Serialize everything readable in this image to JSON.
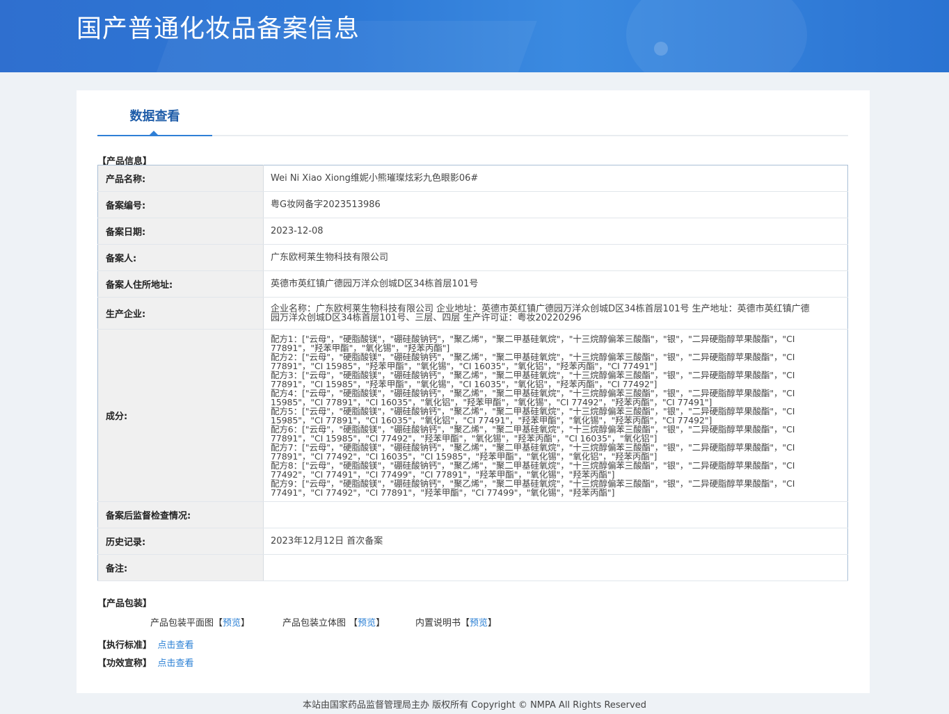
{
  "header": {
    "title": "国产普通化妆品备案信息"
  },
  "tab": {
    "label": "数据查看"
  },
  "sections": {
    "product_info": "【产品信息】",
    "packaging": "【产品包装】",
    "standard": "【执行标准】",
    "efficacy": "【功效宣称】"
  },
  "rows": [
    {
      "label": "产品名称:",
      "value": "Wei Ni Xiao Xiong维妮小熊璀璨炫彩九色眼影06#"
    },
    {
      "label": "备案编号:",
      "value": "粤G妆网备字2023513986"
    },
    {
      "label": "备案日期:",
      "value": "2023-12-08"
    },
    {
      "label": "备案人:",
      "value": "广东欧柯莱生物科技有限公司"
    },
    {
      "label": "备案人住所地址:",
      "value": "英德市英红镇广德园万洋众创城D区34栋首层101号"
    },
    {
      "label": "生产企业:",
      "value": "企业名称：广东欧柯莱生物科技有限公司 企业地址：英德市英红镇广德园万洋众创城D区34栋首层101号 生产地址：英德市英红镇广德园万洋众创城D区34栋首层101号、三层、四层 生产许可证：粤妆20220296"
    },
    {
      "label": "成分:",
      "value": ""
    },
    {
      "label": "备案后监督检查情况:",
      "value": ""
    },
    {
      "label": "历史记录:",
      "value": "2023年12月12日 首次备案"
    },
    {
      "label": "备注:",
      "value": ""
    }
  ],
  "ingredients": [
    "配方1：[\"云母\"，\"硬脂酸镁\"，\"硼硅酸钠钙\"，\"聚乙烯\"，\"聚二甲基硅氧烷\"，\"十三烷醇偏苯三酸酯\"，\"银\"，\"二异硬脂醇苹果酸酯\"，\"CI 77891\"，\"羟苯甲酯\"，\"氧化锡\"，\"羟苯丙酯\"]",
    "配方2：[\"云母\"，\"硬脂酸镁\"，\"硼硅酸钠钙\"，\"聚乙烯\"，\"聚二甲基硅氧烷\"，\"十三烷醇偏苯三酸酯\"，\"银\"，\"二异硬脂醇苹果酸酯\"，\"CI 77891\"，\"CI 15985\"，\"羟苯甲酯\"，\"氧化锡\"，\"CI 16035\"，\"氧化铝\"，\"羟苯丙酯\"，\"CI 77491\"]",
    "配方3：[\"云母\"，\"硬脂酸镁\"，\"硼硅酸钠钙\"，\"聚乙烯\"，\"聚二甲基硅氧烷\"，\"十三烷醇偏苯三酸酯\"，\"银\"，\"二异硬脂醇苹果酸酯\"，\"CI 77891\"，\"CI 15985\"，\"羟苯甲酯\"，\"氧化锡\"，\"CI 16035\"，\"氧化铝\"，\"羟苯丙酯\"，\"CI 77492\"]",
    "配方4：[\"云母\"，\"硬脂酸镁\"，\"硼硅酸钠钙\"，\"聚乙烯\"，\"聚二甲基硅氧烷\"，\"十三烷醇偏苯三酸酯\"，\"银\"，\"二异硬脂醇苹果酸酯\"，\"CI 15985\"，\"CI 77891\"，\"CI 16035\"，\"氧化铝\"，\"羟苯甲酯\"，\"氧化锡\"，\"CI 77492\"，\"羟苯丙酯\"，\"CI 77491\"]",
    "配方5：[\"云母\"，\"硬脂酸镁\"，\"硼硅酸钠钙\"，\"聚乙烯\"，\"聚二甲基硅氧烷\"，\"十三烷醇偏苯三酸酯\"，\"银\"，\"二异硬脂醇苹果酸酯\"，\"CI 15985\"，\"CI 77891\"，\"CI 16035\"，\"氧化铝\"，\"CI 77491\"，\"羟苯甲酯\"，\"氧化锡\"，\"羟苯丙酯\"，\"CI 77492\"]",
    "配方6：[\"云母\"，\"硬脂酸镁\"，\"硼硅酸钠钙\"，\"聚乙烯\"，\"聚二甲基硅氧烷\"，\"十三烷醇偏苯三酸酯\"，\"银\"，\"二异硬脂醇苹果酸酯\"，\"CI 77891\"，\"CI 15985\"，\"CI 77492\"，\"羟苯甲酯\"，\"氧化锡\"，\"羟苯丙酯\"，\"CI 16035\"，\"氧化铝\"]",
    "配方7：[\"云母\"，\"硬脂酸镁\"，\"硼硅酸钠钙\"，\"聚乙烯\"，\"聚二甲基硅氧烷\"，\"十三烷醇偏苯三酸酯\"，\"银\"，\"二异硬脂醇苹果酸酯\"，\"CI 77891\"，\"CI 77492\"，\"CI 16035\"，\"CI 15985\"，\"羟苯甲酯\"，\"氧化锡\"，\"氧化铝\"，\"羟苯丙酯\"]",
    "配方8：[\"云母\"，\"硬脂酸镁\"，\"硼硅酸钠钙\"，\"聚乙烯\"，\"聚二甲基硅氧烷\"，\"十三烷醇偏苯三酸酯\"，\"银\"，\"二异硬脂醇苹果酸酯\"，\"CI 77492\"，\"CI 77491\"，\"CI 77499\"，\"CI 77891\"，\"羟苯甲酯\"，\"氧化锡\"，\"羟苯丙酯\"]",
    "配方9：[\"云母\"，\"硬脂酸镁\"，\"硼硅酸钠钙\"，\"聚乙烯\"，\"聚二甲基硅氧烷\"，\"十三烷醇偏苯三酸酯\"，\"银\"，\"二异硬脂醇苹果酸酯\"，\"CI 77491\"，\"CI 77492\"，\"CI 77891\"，\"羟苯甲酯\"，\"CI 77499\"，\"氧化锡\"，\"羟苯丙酯\"]"
  ],
  "packaging": {
    "flat_label": "产品包装平面图",
    "solid_label": "产品包装立体图",
    "manual_label": "内置说明书",
    "bracket_open": "【",
    "bracket_close": "】",
    "preview": "预览"
  },
  "links": {
    "view": "点击查看"
  },
  "footer": {
    "text": "本站由国家药品监督管理局主办 版权所有 Copyright © NMPA All Rights Reserved"
  }
}
